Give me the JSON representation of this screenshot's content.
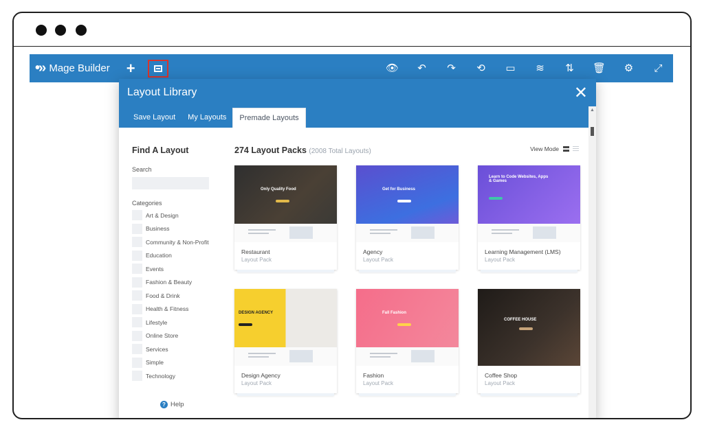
{
  "app": {
    "name": "Mage Builder"
  },
  "toolbar": {
    "right_icons": [
      {
        "name": "preview-eye-icon",
        "glyph": "👁"
      },
      {
        "name": "undo-icon",
        "glyph": "↶"
      },
      {
        "name": "redo-icon",
        "glyph": "↷"
      },
      {
        "name": "history-icon",
        "glyph": "⟲"
      },
      {
        "name": "portability-icon",
        "glyph": "▭"
      },
      {
        "name": "layers-icon",
        "glyph": "≋"
      },
      {
        "name": "sort-icon",
        "glyph": "⇅"
      },
      {
        "name": "trash-icon",
        "glyph": "🗑"
      },
      {
        "name": "settings-gear-icon",
        "glyph": "⚙"
      },
      {
        "name": "expand-icon",
        "glyph": "⤢"
      }
    ]
  },
  "modal": {
    "title": "Layout Library",
    "close_glyph": "✕",
    "tabs": [
      {
        "label": "Save Layout",
        "active": false
      },
      {
        "label": "My Layouts",
        "active": false
      },
      {
        "label": "Premade Layouts",
        "active": true
      }
    ]
  },
  "sidebar": {
    "title": "Find A Layout",
    "search_label": "Search",
    "search_value": "",
    "categories_label": "Categories",
    "categories": [
      "Art & Design",
      "Business",
      "Community & Non-Profit",
      "Education",
      "Events",
      "Fashion & Beauty",
      "Food & Drink",
      "Health & Fitness",
      "Lifestyle",
      "Online Store",
      "Services",
      "Simple",
      "Technology"
    ],
    "help_label": "Help"
  },
  "main": {
    "title": "274 Layout Packs",
    "subtitle": "(2008 Total Layouts)",
    "view_mode_label": "View Mode",
    "cards": [
      {
        "name": "Restaurant",
        "type": "Layout Pack",
        "hero_text": "Only Quality Food",
        "theme": "restaurant"
      },
      {
        "name": "Agency",
        "type": "Layout Pack",
        "hero_text": "Get for Business",
        "theme": "agency"
      },
      {
        "name": "Learning Management (LMS)",
        "type": "Layout Pack",
        "hero_text": "Learn to Code Websites, Apps & Games",
        "theme": "lms"
      },
      {
        "name": "Design Agency",
        "type": "Layout Pack",
        "hero_text": "DESIGN AGENCY",
        "theme": "design"
      },
      {
        "name": "Fashion",
        "type": "Layout Pack",
        "hero_text": "Fall Fashion",
        "theme": "fashion"
      },
      {
        "name": "Coffee Shop",
        "type": "Layout Pack",
        "hero_text": "COFFEE HOUSE",
        "theme": "coffee"
      }
    ]
  },
  "colors": {
    "primary": "#2b7fc2",
    "highlight_border": "#d9342b"
  }
}
